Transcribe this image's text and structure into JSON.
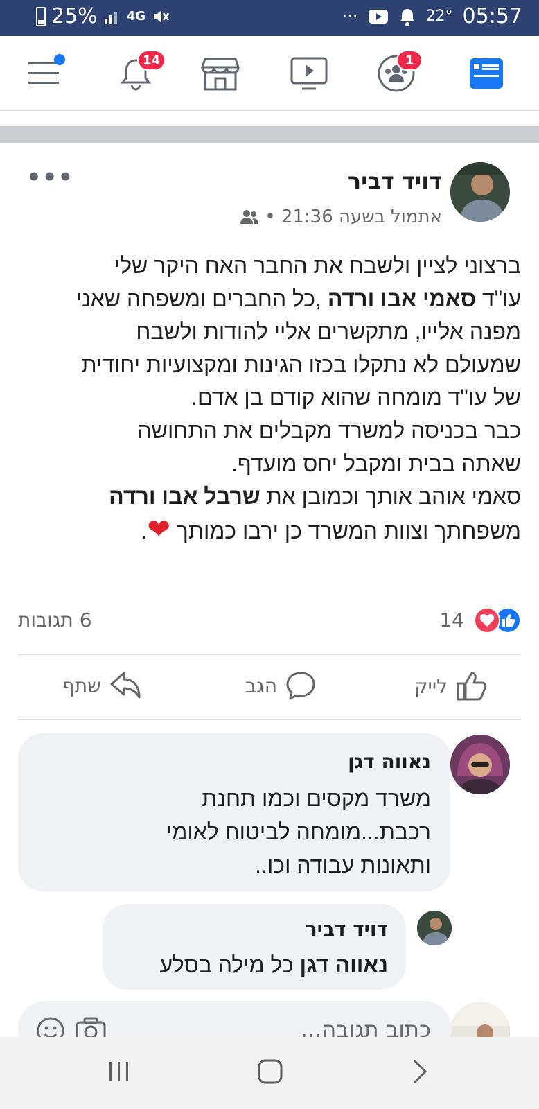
{
  "status_bar": {
    "battery": "25%",
    "network": "4G",
    "temperature": "22°",
    "time": "05:57"
  },
  "nav": {
    "notifications_badge": "14",
    "groups_badge": "1",
    "accent": "#1877f2",
    "badge_color": "#f02849"
  },
  "post": {
    "author": "דויד דביר",
    "meta": "אתמול בשעה 21:36 •",
    "audience_icon": "friends-icon",
    "body": {
      "l1": "ברצוני לציין ולשבח את החבר האח היקר שלי",
      "l2a": "עו\"ד ",
      "l2b": "סאמי אבו ורדה",
      "l2c": " ,כל החברים ומשפחה שאני",
      "l3": "מפנה אלייו, מתקשרים אליי להודות ולשבח",
      "l4": "שמעולם לא נתקלו בכזו הגינות ומקצועיות יחודית",
      "l5": "של עו\"ד מומחה שהוא קודם בן אדם.",
      "l6": "כבר בכניסה למשרד מקבלים את התחושה",
      "l7": "שאתה בבית ומקבל יחס מועדף.",
      "l8a": "סאמי אוהב אותך וכמובן את ",
      "l8b": "שרבל אבו ורדה",
      "l9a": "משפחתך וצוות המשרד כן ירבו כמותך ",
      "l9b": "❤",
      "l9c": "."
    },
    "reactions_count": "14",
    "comments_count": "6 תגובות",
    "actions": {
      "like": "לייק",
      "comment": "הגב",
      "share": "שתף"
    }
  },
  "comments": [
    {
      "name": "נאווה דגן",
      "lines": [
        "משרד מקסים וכמו תחנת",
        "רכבת...מומחה לביטוח לאומי",
        "ותאונות עבודה וכו.."
      ]
    },
    {
      "name": "דויד דביר",
      "mention": "נאווה דגן",
      "text": " כל מילה בסלע"
    }
  ],
  "composer": {
    "placeholder": "כתוב תגובה..."
  }
}
